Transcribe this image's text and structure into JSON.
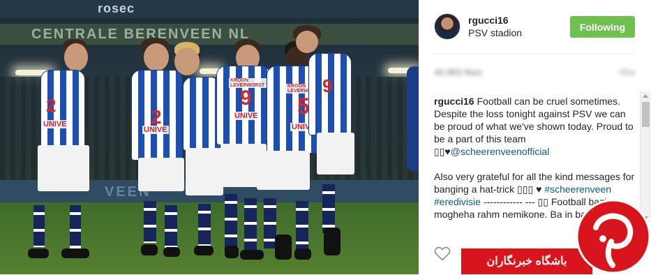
{
  "post": {
    "username": "rgucci16",
    "location": "PSV stadion",
    "follow_label": "Following",
    "likes_blurred": "46,883 likes",
    "time_blurred": "45w"
  },
  "caption": {
    "author": "rgucci16",
    "line1": "Football can be cruel sometimes. Despite the loss tonight against PSV we can be proud of what we've shown today. Proud to be a part of this team ",
    "emoji1": "▯▯♥",
    "mention": "@scheerenveenofficial",
    "line2": "Also very grateful for all the kind messages for banging a hat-trick ",
    "emoji2": "▯▯▯ ♥",
    "hashtag1": "#scheerenveen",
    "hashtag2": "#eredivisie",
    "dashes": " ------------",
    "line3": "--- ▯▯ Football bazi mogheha rahm nemikone. Ba in bakhte talkhe"
  },
  "photo": {
    "board_a": "",
    "board_b": "rosec",
    "ad_top": "CENTRALE BERENVEEN NL",
    "ad_low": "VEEN",
    "numbers": [
      "2",
      "9",
      "5",
      "2",
      "9"
    ],
    "sponsor": "KROON LEVERWORST",
    "shirt_text": "UNIVE"
  },
  "watermark": {
    "text": "باشگاه خبرنگاران"
  },
  "colors": {
    "follow_bg": "#70c050",
    "link": "#125688",
    "watermark_red": "#d8141c",
    "jersey_blue": "#1d4fb0"
  },
  "icons": {
    "like": "heart-outline-icon",
    "logo": "yjc-logo-icon"
  }
}
